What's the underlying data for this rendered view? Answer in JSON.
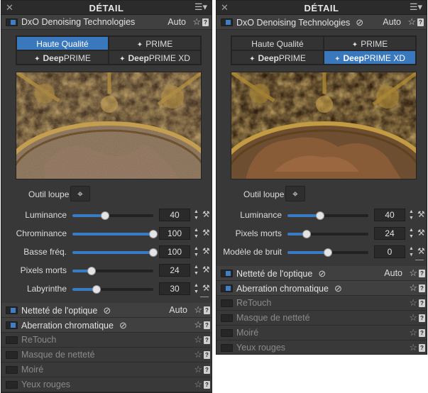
{
  "panel_title": "DÉTAIL",
  "icons": {
    "close": "close-icon",
    "menu": "menu-icon",
    "star": "star-icon",
    "help": "help-icon",
    "eye": "hidden-eye-icon",
    "loupe": "crosshair-icon",
    "wand": "magic-wand-icon"
  },
  "colors": {
    "accent": "#3a78bd",
    "panel_bg": "#383838"
  },
  "left": {
    "denoise": {
      "label": "DxO Denoising Technologies",
      "auto": "Auto"
    },
    "modes": [
      {
        "label": "Haute Qualité",
        "selected": true
      },
      {
        "label": "PRIME",
        "selected": false
      },
      {
        "label_bold": "Deep",
        "label_rest": "PRIME",
        "selected": false
      },
      {
        "label_bold": "Deep",
        "label_rest": "PRIME XD",
        "selected": false
      }
    ],
    "loupe_label": "Outil loupe",
    "sliders": [
      {
        "label": "Luminance",
        "value": "40",
        "fraction": 0.4
      },
      {
        "label": "Chrominance",
        "value": "100",
        "fraction": 1.0
      },
      {
        "label": "Basse fréq.",
        "value": "100",
        "fraction": 1.0
      },
      {
        "label": "Pixels morts",
        "value": "24",
        "fraction": 0.24
      },
      {
        "label": "Labyrinthe",
        "value": "30",
        "fraction": 0.3
      }
    ],
    "sections": [
      {
        "label": "Netteté de l'optique",
        "checked": true,
        "eye": true,
        "auto": "Auto",
        "disabled": false
      },
      {
        "label": "Aberration chromatique",
        "checked": true,
        "eye": true,
        "auto": "",
        "disabled": false
      },
      {
        "label": "ReTouch",
        "checked": false,
        "eye": false,
        "auto": "",
        "disabled": true
      },
      {
        "label": "Masque de netteté",
        "checked": false,
        "eye": false,
        "auto": "",
        "disabled": true
      },
      {
        "label": "Moiré",
        "checked": false,
        "eye": false,
        "auto": "",
        "disabled": true
      },
      {
        "label": "Yeux rouges",
        "checked": false,
        "eye": false,
        "auto": "",
        "disabled": true
      }
    ]
  },
  "right": {
    "denoise": {
      "label": "DxO Denoising Technologies",
      "auto": "Auto"
    },
    "modes": [
      {
        "label": "Haute Qualité",
        "selected": false
      },
      {
        "label": "PRIME",
        "selected": false
      },
      {
        "label_bold": "Deep",
        "label_rest": "PRIME",
        "selected": false
      },
      {
        "label_bold": "Deep",
        "label_rest": "PRIME XD",
        "selected": true
      }
    ],
    "loupe_label": "Outil loupe",
    "sliders": [
      {
        "label": "Luminance",
        "value": "40",
        "fraction": 0.4
      },
      {
        "label": "Pixels morts",
        "value": "24",
        "fraction": 0.24
      },
      {
        "label": "Modèle de bruit",
        "value": "0",
        "fraction": 0.5
      }
    ],
    "sections": [
      {
        "label": "Netteté de l'optique",
        "checked": true,
        "eye": true,
        "auto": "Auto",
        "disabled": false
      },
      {
        "label": "Aberration chromatique",
        "checked": true,
        "eye": true,
        "auto": "",
        "disabled": false
      },
      {
        "label": "ReTouch",
        "checked": false,
        "eye": false,
        "auto": "",
        "disabled": true
      },
      {
        "label": "Masque de netteté",
        "checked": false,
        "eye": false,
        "auto": "",
        "disabled": true
      },
      {
        "label": "Moiré",
        "checked": false,
        "eye": false,
        "auto": "",
        "disabled": true
      },
      {
        "label": "Yeux rouges",
        "checked": false,
        "eye": false,
        "auto": "",
        "disabled": true
      }
    ]
  }
}
